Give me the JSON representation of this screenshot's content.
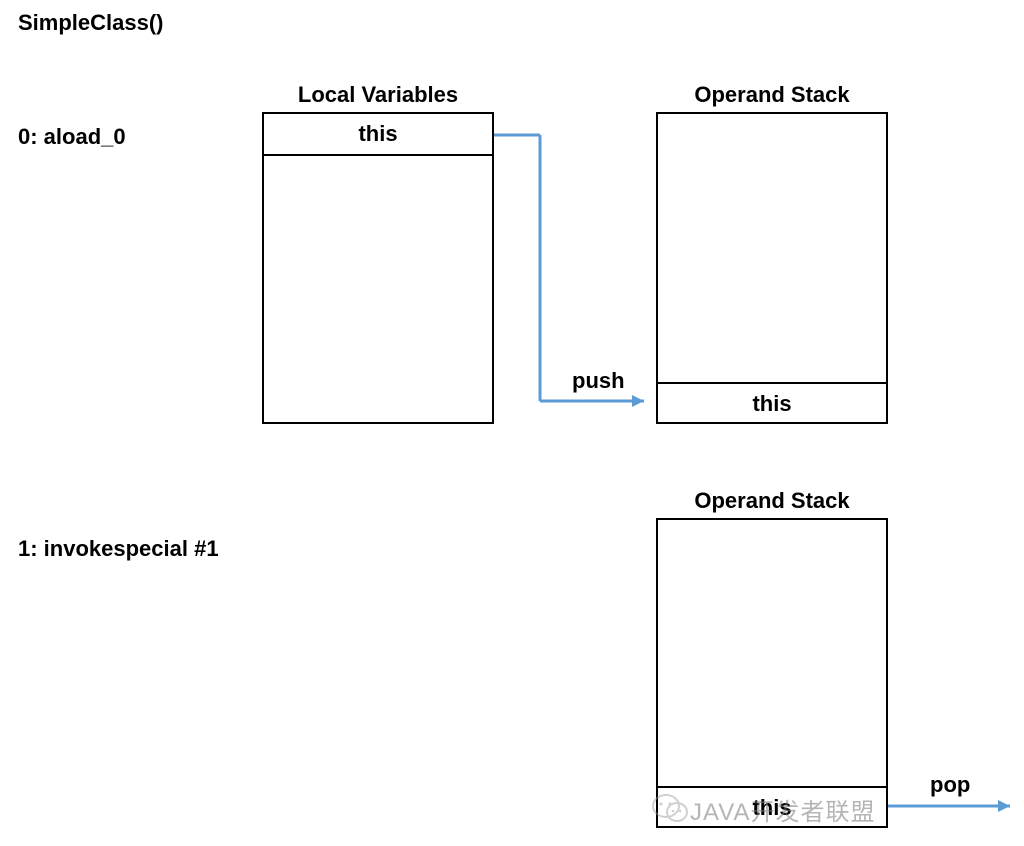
{
  "title": "SimpleClass()",
  "instructions": {
    "first": "0: aload_0",
    "second": "1: invokespecial #1"
  },
  "boxes": {
    "local_vars_title": "Local Variables",
    "operand_stack_title_1": "Operand Stack",
    "operand_stack_title_2": "Operand Stack",
    "local_vars_cell": "this",
    "operand_stack_1_cell": "this",
    "operand_stack_2_cell": "this"
  },
  "arrows": {
    "push_label": "push",
    "pop_label": "pop"
  },
  "watermark": "JAVA开发者联盟",
  "colors": {
    "arrow": "#5b9bd5",
    "border": "#000000"
  }
}
